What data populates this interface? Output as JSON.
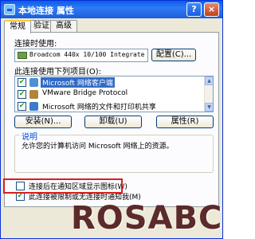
{
  "window": {
    "title": "本地连接 属性",
    "help_symbol": "?",
    "close_symbol": "×"
  },
  "tabs": [
    {
      "label": "常规",
      "active": true
    },
    {
      "label": "验证",
      "active": false
    },
    {
      "label": "高级",
      "active": false
    }
  ],
  "connect_using": {
    "label": "连接时使用:",
    "adapter": "Broadcom 440x 10/100 Integrate",
    "configure_button": "配置(C)..."
  },
  "components": {
    "label": "此连接使用下列项目(O):",
    "items": [
      {
        "text": "Microsoft 网络客户端",
        "checked": true,
        "selected": true,
        "icon": "network-client-icon"
      },
      {
        "text": "VMware Bridge Protocol",
        "checked": true,
        "selected": false,
        "icon": "protocol-icon"
      },
      {
        "text": "Microsoft 网络的文件和打印机共享",
        "checked": true,
        "selected": false,
        "icon": "file-share-icon"
      }
    ],
    "check_glyph": "✔",
    "scroll_up": "▲",
    "scroll_down": "▼"
  },
  "buttons": {
    "install": "安装(N)...",
    "uninstall": "卸载(U)",
    "properties": "属性(R)"
  },
  "description": {
    "title": "说明",
    "text": "允许您的计算机访问 Microsoft 网络上的资源。"
  },
  "options": [
    {
      "text": "连接后在通知区域显示图标(W)",
      "checked": false
    },
    {
      "text": "此连接被限制或无连接时通知我(M)",
      "checked": true
    }
  ],
  "watermark": "ROSABC",
  "colors": {
    "highlight": "#d9201c",
    "titlebar": "#0a5de8",
    "selection": "#316ac5"
  }
}
